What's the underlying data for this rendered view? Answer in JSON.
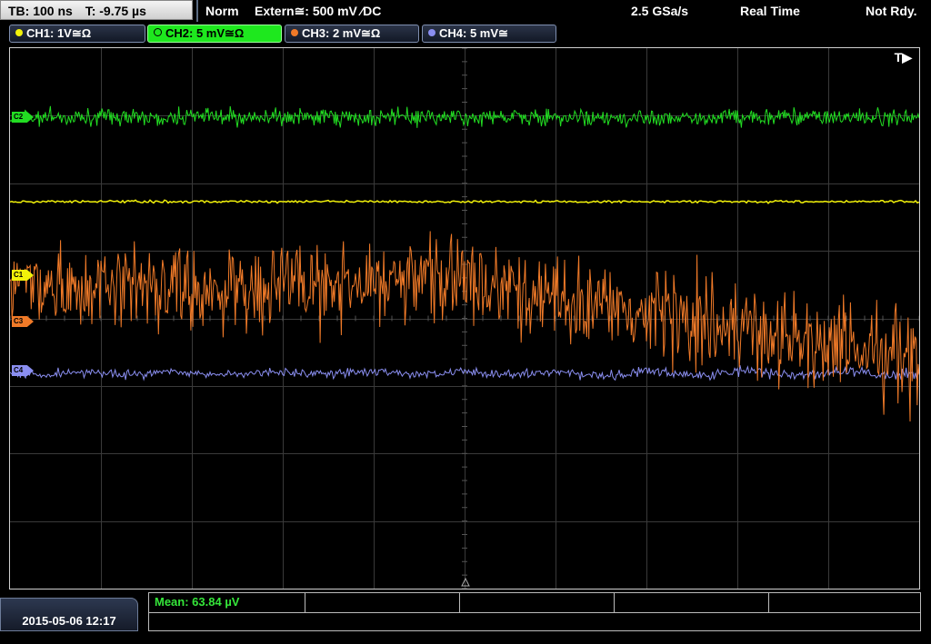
{
  "topbar": {
    "timebase": "TB: 100 ns",
    "trigger_offset": "T: -9.75 µs",
    "mode": "Norm",
    "trigger_source": "Extern≅: 500 mV ⁄DC",
    "sample_rate": "2.5 GSa/s",
    "acq_mode": "Real Time",
    "status": "Not Rdy."
  },
  "channels": [
    {
      "label": "CH1: 1V≅Ω",
      "color": "#f2f20a",
      "active": false
    },
    {
      "label": "CH2: 5 mV≅Ω",
      "color": "#1ee81e",
      "active": true
    },
    {
      "label": "CH3: 2 mV≅Ω",
      "color": "#f07a28",
      "active": false
    },
    {
      "label": "CH4: 5 mV≅",
      "color": "#8a8ef0",
      "active": false
    }
  ],
  "display": {
    "trigger_indicator": "T▶",
    "markers": {
      "c1": "C1",
      "c2": "C2",
      "c3": "C3",
      "c4": "C4"
    }
  },
  "traces": {
    "ch2": {
      "color": "#22dd22"
    },
    "ch1": {
      "color": "#f2f20a"
    },
    "ch3": {
      "color": "#f07a28"
    },
    "ch4": {
      "color": "#8a8ef0"
    }
  },
  "grid": {
    "color": "#3a3a3a",
    "h_divs": 10,
    "v_divs": 8
  },
  "bottom": {
    "timestamp": "2015-05-06 12:17",
    "measurement": "Mean: 63.84 µV"
  }
}
